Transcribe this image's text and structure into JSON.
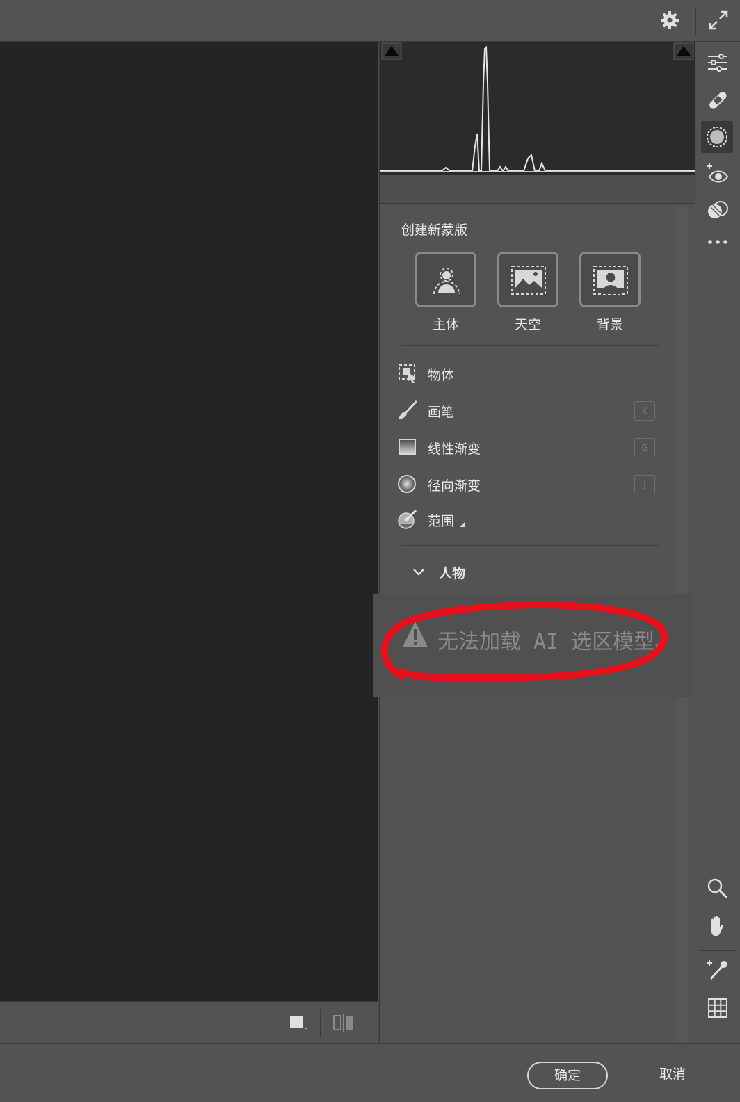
{
  "topbar": {
    "settings_icon": "gear-icon",
    "fullscreen_icon": "expand-arrows-icon"
  },
  "histogram": {
    "shadow_clip_icon": "shadow-clipping-icon",
    "highlight_clip_icon": "highlight-clipping-icon"
  },
  "masking": {
    "title": "创建新蒙版",
    "quick_masks": [
      {
        "label": "主体",
        "icon": "subject-icon"
      },
      {
        "label": "天空",
        "icon": "sky-icon"
      },
      {
        "label": "背景",
        "icon": "background-icon"
      }
    ],
    "tools": [
      {
        "label": "物体",
        "icon": "object-select-icon",
        "shortcut": ""
      },
      {
        "label": "画笔",
        "icon": "brush-icon",
        "shortcut": "K"
      },
      {
        "label": "线性渐变",
        "icon": "linear-gradient-icon",
        "shortcut": "G"
      },
      {
        "label": "径向渐变",
        "icon": "radial-gradient-icon",
        "shortcut": "J"
      },
      {
        "label": "范围",
        "icon": "range-icon",
        "shortcut": ""
      }
    ],
    "people_section": {
      "label": "人物",
      "expanded": true
    },
    "warning": {
      "text": "无法加载 AI 选区模型。",
      "icon": "warning-triangle-icon"
    }
  },
  "annotation_color": "#e8101a",
  "buttons": {
    "ok": "确定",
    "cancel": "取消"
  }
}
